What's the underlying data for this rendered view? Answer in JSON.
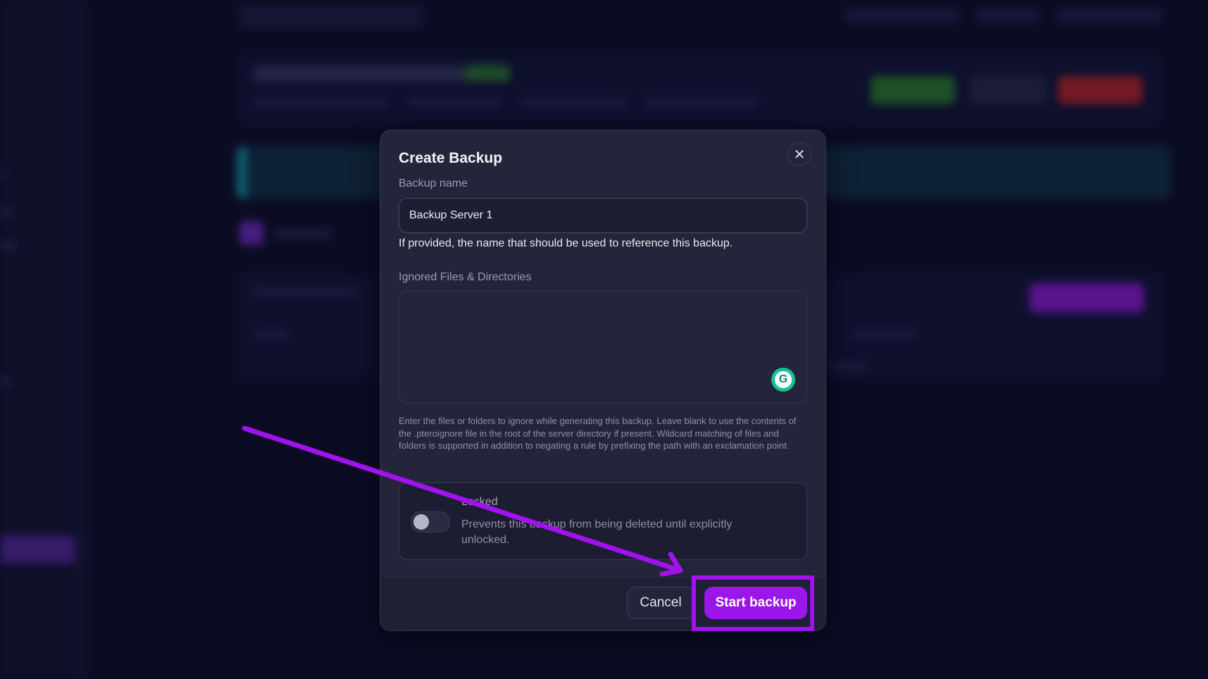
{
  "modal": {
    "title": "Create Backup",
    "close_icon": "close-icon",
    "backup_name": {
      "label": "Backup name",
      "value": "Backup Server 1",
      "help": "If provided, the name that should be used to reference this backup."
    },
    "ignored": {
      "label": "Ignored Files & Directories",
      "value": "",
      "help": "Enter the files or folders to ignore while generating this backup. Leave blank to use the contents of the .pteroignore file in the root of the server directory if present. Wildcard matching of files and folders is supported in addition to negating a rule by prefixing the path with an exclamation point."
    },
    "locked": {
      "title": "Locked",
      "description": "Prevents this backup from being deleted until explicitly unlocked.",
      "enabled": false
    },
    "buttons": {
      "cancel": "Cancel",
      "start": "Start backup"
    }
  },
  "annotations": {
    "accent_color": "#a012ee"
  },
  "colors": {
    "primary": "#9b16e8",
    "modal_bg": "#24253a",
    "page_bg": "#0d0f29"
  }
}
